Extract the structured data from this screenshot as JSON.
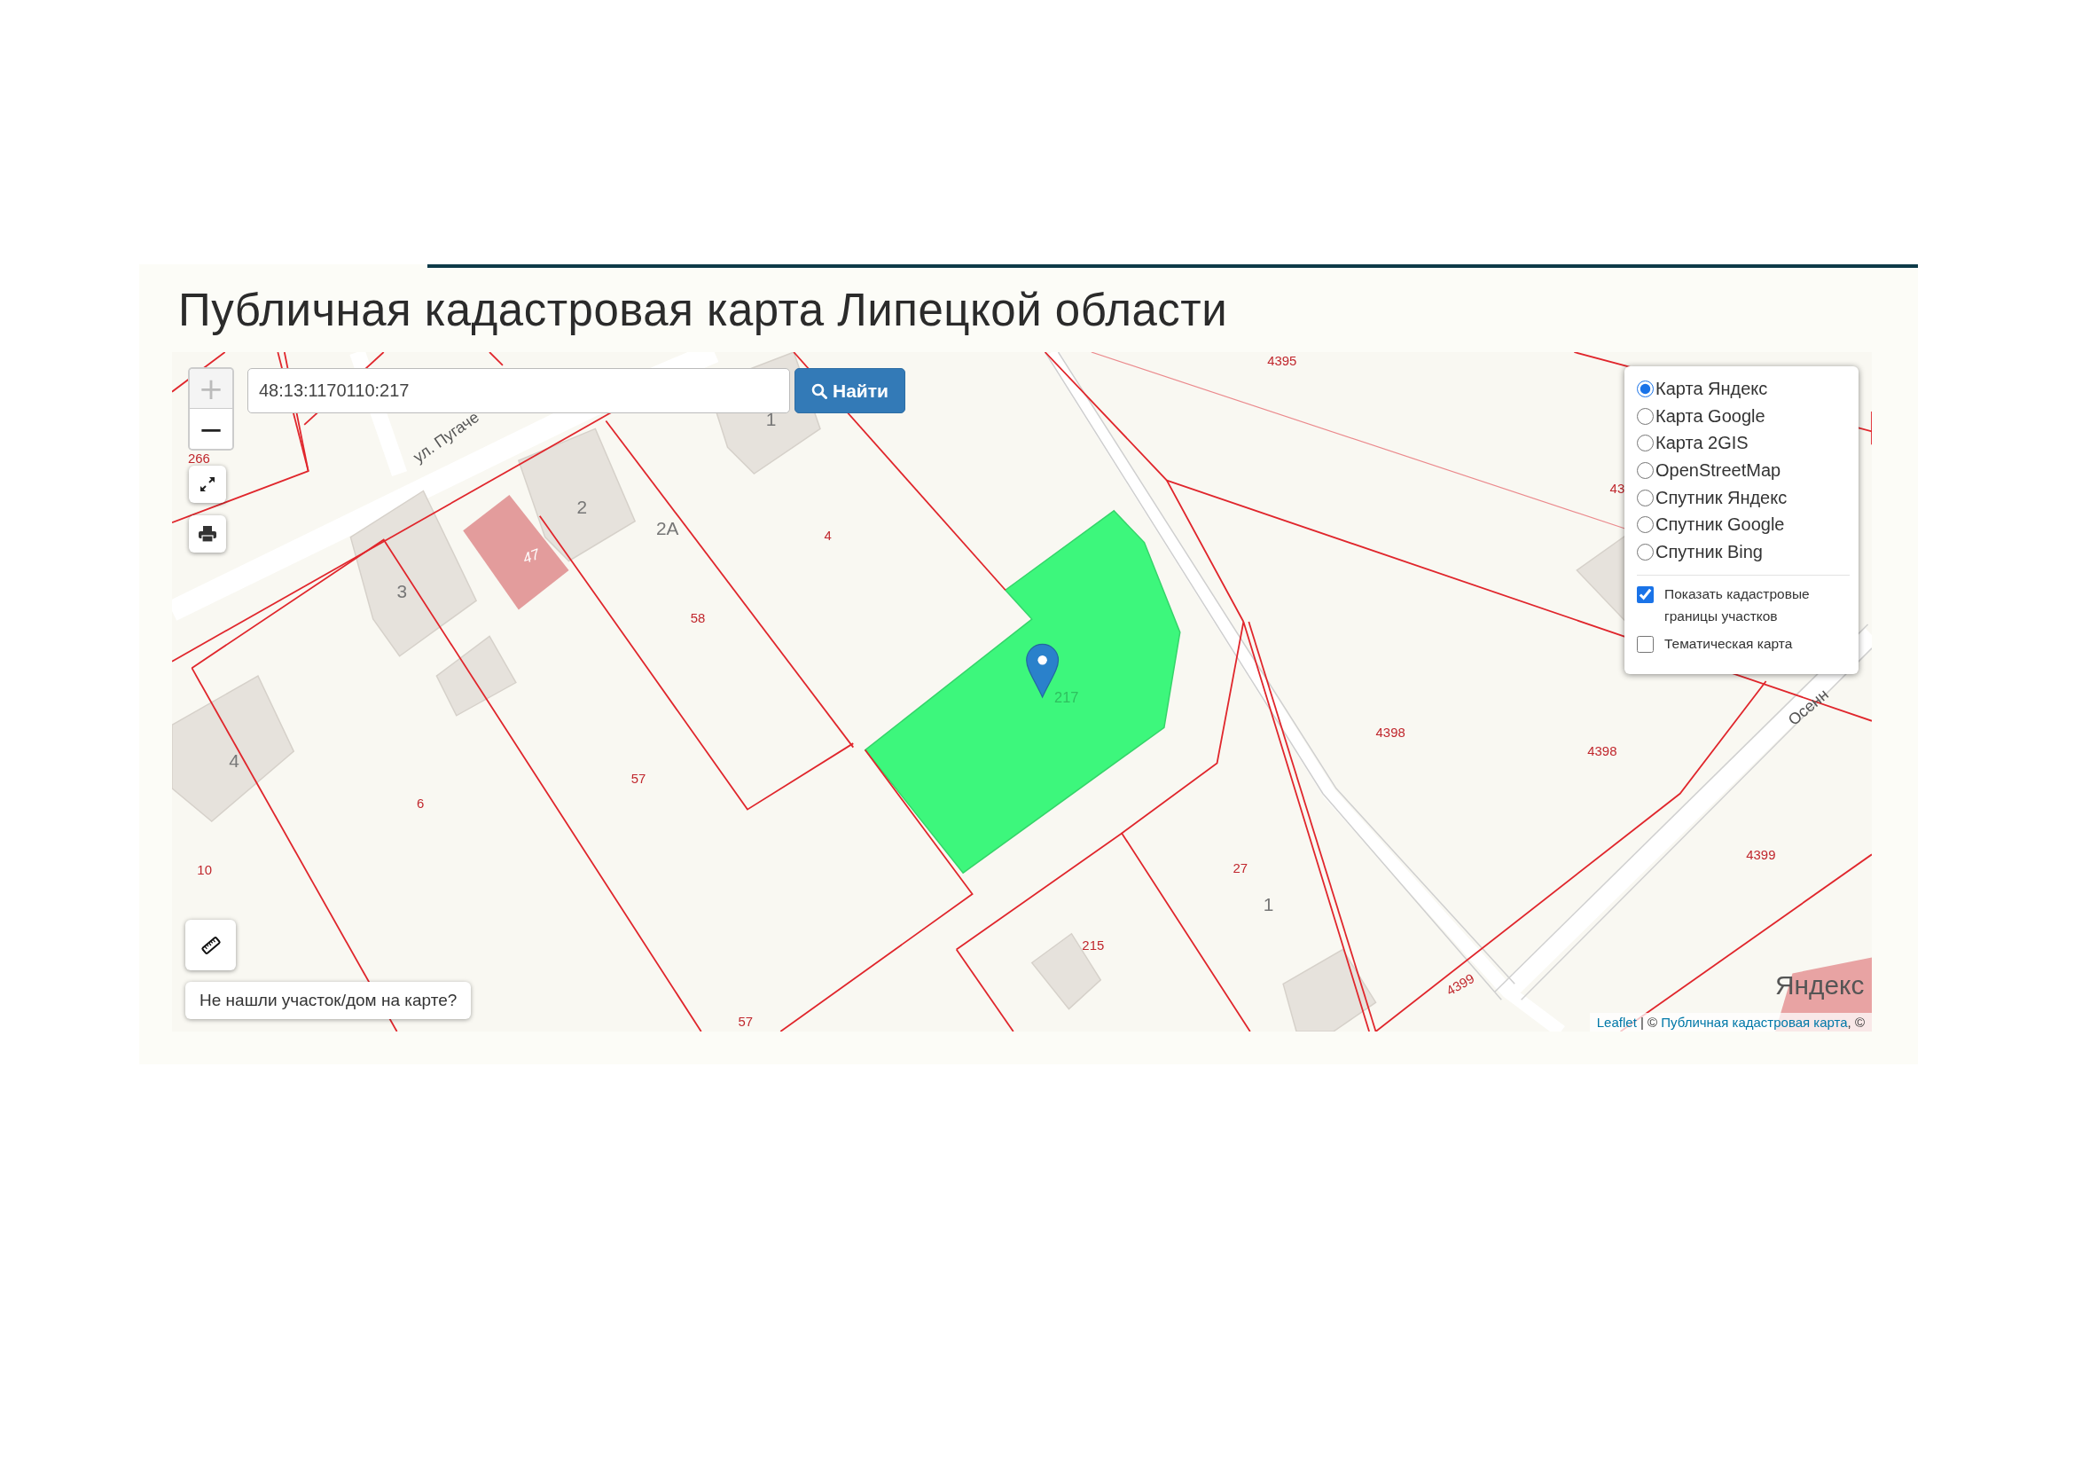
{
  "page": {
    "title": "Публичная кадастровая карта Липецкой области"
  },
  "map": {
    "zoom_in": "+",
    "zoom_out": "−",
    "search": {
      "value": "48:13:1170110:217",
      "button": "Найти"
    },
    "not_found_button": "Не нашли участок/дом на карте?",
    "labels": [
      {
        "text": "266",
        "kind": "parcel"
      },
      {
        "text": "4",
        "kind": "parcel"
      },
      {
        "text": "58",
        "kind": "parcel"
      },
      {
        "text": "57",
        "kind": "parcel"
      },
      {
        "text": "6",
        "kind": "parcel"
      },
      {
        "text": "10",
        "kind": "parcel"
      },
      {
        "text": "47",
        "kind": "inverse"
      },
      {
        "text": "2",
        "kind": "building"
      },
      {
        "text": "2A",
        "kind": "building"
      },
      {
        "text": "3",
        "kind": "building"
      },
      {
        "text": "1",
        "kind": "building"
      },
      {
        "text": "4",
        "kind": "building"
      },
      {
        "text": "217",
        "kind": "faint"
      },
      {
        "text": "4395",
        "kind": "parcel"
      },
      {
        "text": "43",
        "kind": "parcel"
      },
      {
        "text": "4398",
        "kind": "parcel"
      },
      {
        "text": "4398",
        "kind": "parcel"
      },
      {
        "text": "4399",
        "kind": "parcel"
      },
      {
        "text": "27",
        "kind": "parcel"
      },
      {
        "text": "1",
        "kind": "building"
      },
      {
        "text": "215",
        "kind": "parcel"
      },
      {
        "text": "4399",
        "kind": "parcel"
      },
      {
        "text": "57",
        "kind": "parcel"
      },
      {
        "text": "ул. Пугаче",
        "kind": "street"
      },
      {
        "text": "Осенн",
        "kind": "street"
      },
      {
        "text": "Яндекс",
        "kind": "logo"
      }
    ],
    "layers": {
      "base": [
        {
          "label": "Карта Яндекс",
          "selected": true
        },
        {
          "label": "Карта Google",
          "selected": false
        },
        {
          "label": "Карта 2GIS",
          "selected": false
        },
        {
          "label": "OpenStreetMap",
          "selected": false
        },
        {
          "label": "Спутник Яндекс",
          "selected": false
        },
        {
          "label": "Спутник Google",
          "selected": false
        },
        {
          "label": "Спутник Bing",
          "selected": false
        }
      ],
      "overlays": [
        {
          "label": "Показать кадастровые границы участков",
          "checked": true
        },
        {
          "label": "Тематическая карта",
          "checked": false
        }
      ]
    },
    "attribution": [
      {
        "text": "Leaflet",
        "kind": "link"
      },
      {
        "text": " | © ",
        "kind": "text"
      },
      {
        "text": "Публичная кадастровая карта",
        "kind": "link"
      },
      {
        "text": ", ©",
        "kind": "text"
      }
    ]
  }
}
